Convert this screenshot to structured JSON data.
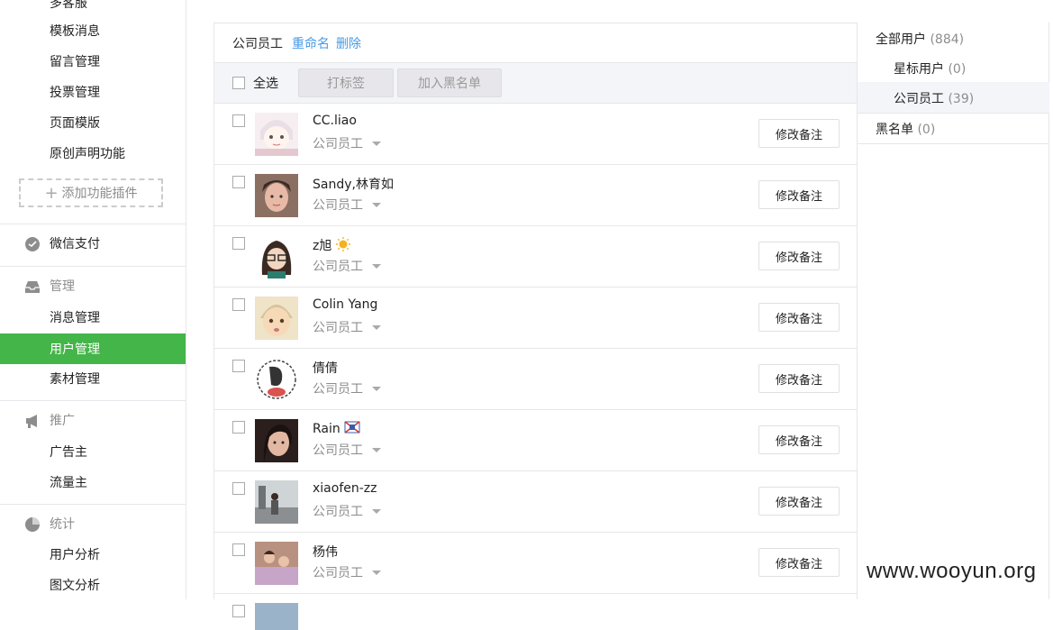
{
  "sidebar": {
    "top_items": [
      "多客服",
      "模板消息",
      "留言管理",
      "投票管理",
      "页面模版",
      "原创声明功能"
    ],
    "add_plugin": "添加功能插件",
    "pay": "微信支付",
    "manage": {
      "label": "管理",
      "items": [
        "消息管理",
        "用户管理",
        "素材管理"
      ]
    },
    "promote": {
      "label": "推广",
      "items": [
        "广告主",
        "流量主"
      ]
    },
    "stats": {
      "label": "统计",
      "items": [
        "用户分析",
        "图文分析"
      ]
    },
    "accent_color": "#44b549"
  },
  "group": {
    "name": "公司员工",
    "rename": "重命名",
    "delete": "删除"
  },
  "toolbar": {
    "select_all": "全选",
    "tag_button": "打标签",
    "blacklist_button": "加入黑名单"
  },
  "users": [
    {
      "name": "CC.liao",
      "group": "公司员工",
      "action": "修改备注"
    },
    {
      "name": "Sandy,林育如",
      "group": "公司员工",
      "action": "修改备注"
    },
    {
      "name": "z旭",
      "group": "公司员工",
      "action": "修改备注"
    },
    {
      "name": "Colin Yang",
      "group": "公司员工",
      "action": "修改备注"
    },
    {
      "name": "倩倩",
      "group": "公司员工",
      "action": "修改备注"
    },
    {
      "name": "Rain",
      "group": "公司员工",
      "action": "修改备注"
    },
    {
      "name": "xiaofen-zz",
      "group": "公司员工",
      "action": "修改备注"
    },
    {
      "name": "杨伟",
      "group": "公司员工",
      "action": "修改备注"
    }
  ],
  "groups_panel": {
    "all": {
      "label": "全部用户",
      "count": "(884)"
    },
    "star": {
      "label": "星标用户",
      "count": "(0)"
    },
    "staff": {
      "label": "公司员工",
      "count": "(39)"
    },
    "black": {
      "label": "黑名单",
      "count": "(0)"
    }
  },
  "watermark": "www.wooyun.org"
}
